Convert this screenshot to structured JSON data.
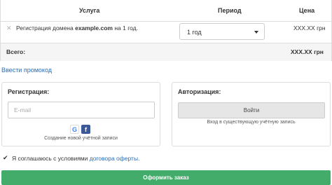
{
  "table": {
    "headers": {
      "service": "Услуга",
      "period": "Период",
      "price": "Цена"
    },
    "row": {
      "remove_icon": "close-icon",
      "service_prefix": "Регистрация домена ",
      "service_domain": "example.com",
      "service_suffix": " на 1 год.",
      "period_selected": "1 год",
      "price": "XXX.XX грн"
    },
    "total_label": "Всего:",
    "total_value": "XXX.XX грн"
  },
  "promo_link": "Ввести промокод",
  "registration": {
    "title": "Регистрация:",
    "email_placeholder": "E-mail",
    "social_icons": [
      "google-icon",
      "facebook-icon"
    ],
    "caption": "Создание новой учётной записи"
  },
  "authorization": {
    "title": "Авторизация:",
    "login_button": "Войти",
    "caption": "Вход в существующую учётную запись"
  },
  "agreement": {
    "checked": true,
    "text": "Я соглашаюсь с условиями ",
    "link": "договора оферты",
    "end": "."
  },
  "submit_button": "Оформить заказ",
  "colors": {
    "link": "#2a6db5",
    "submit": "#43ac6a",
    "facebook": "#3b5998"
  }
}
